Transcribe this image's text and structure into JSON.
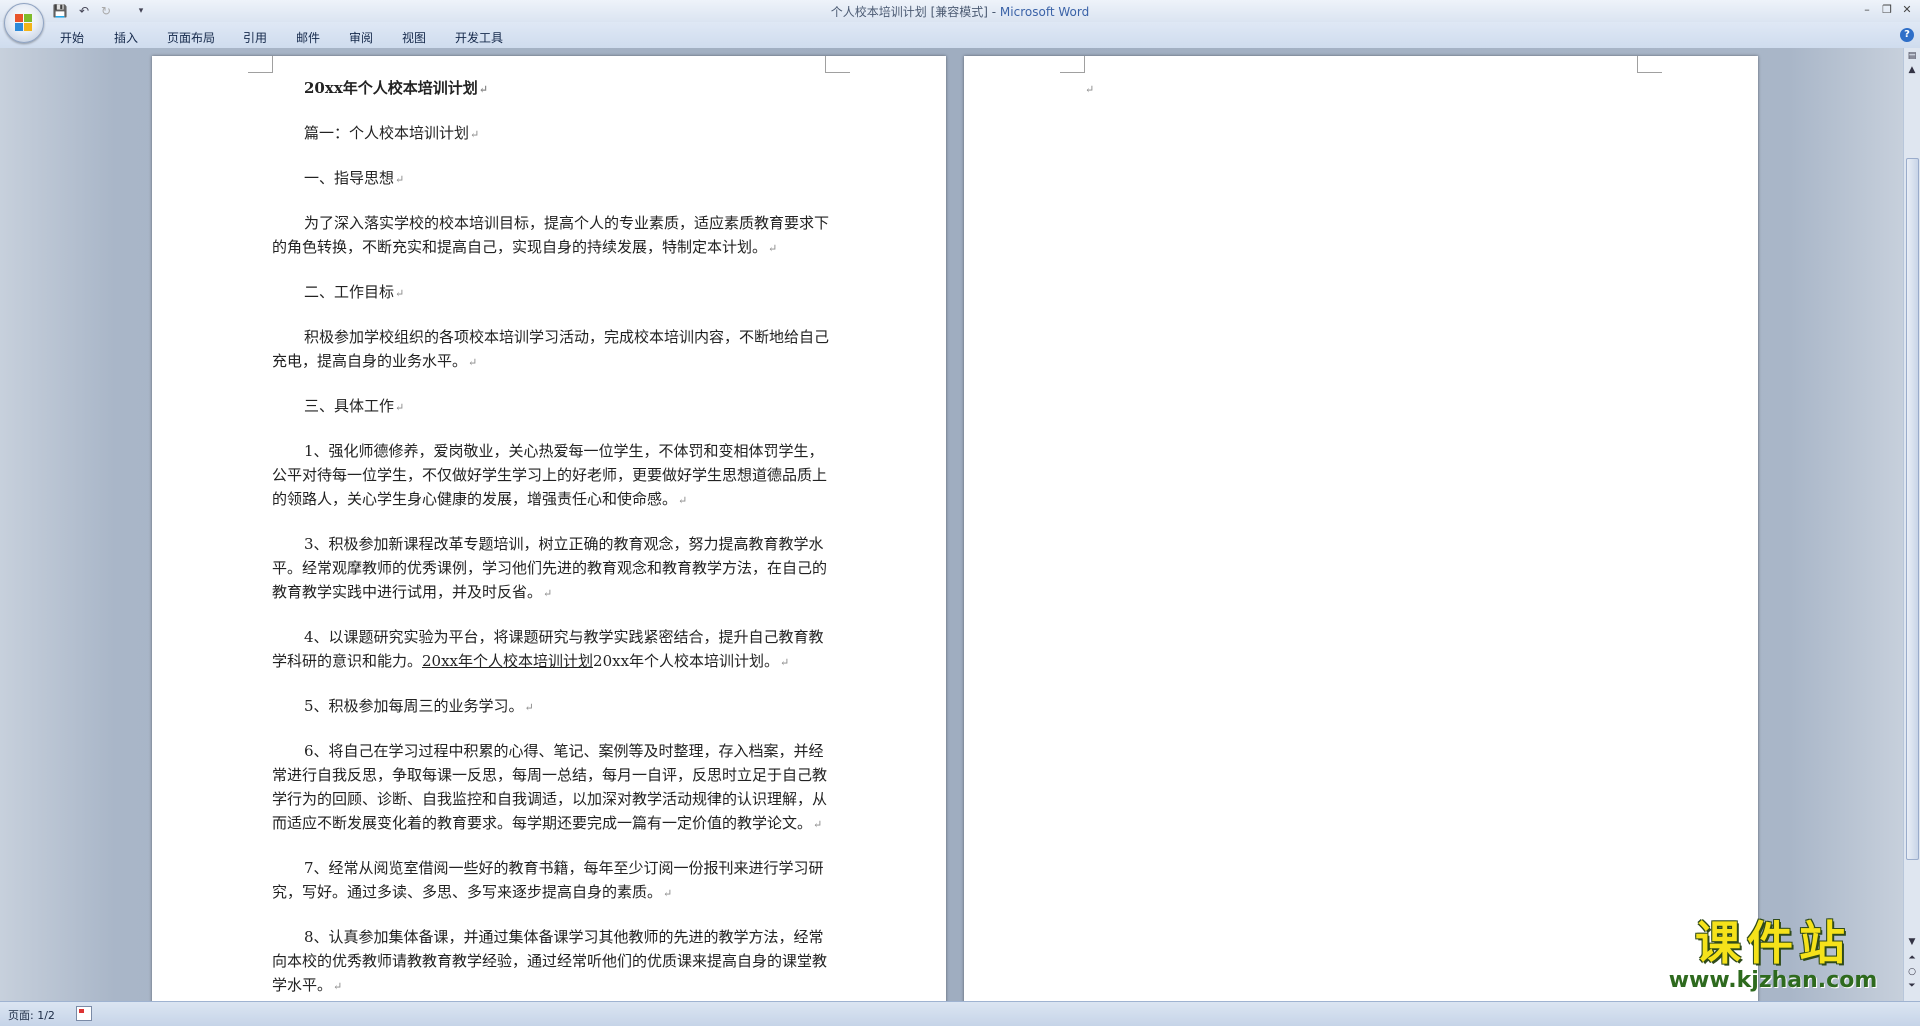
{
  "window": {
    "title": "个人校本培训计划 [兼容模式] - ",
    "app_name": "Microsoft Word"
  },
  "quick_access": [
    "save-icon",
    "undo-icon",
    "redo-icon",
    "customize-icon"
  ],
  "ribbon": {
    "tabs": [
      "开始",
      "插入",
      "页面布局",
      "引用",
      "邮件",
      "审阅",
      "视图",
      "开发工具"
    ]
  },
  "document": {
    "title": "20xx年个人校本培训计划",
    "paragraphs": [
      "篇一：个人校本培训计划",
      "一、指导思想",
      "为了深入落实学校的校本培训目标，提高个人的专业素质，适应素质教育要求下的角色转换，不断充实和提高自己，实现自身的持续发展，特制定本计划。",
      "二、工作目标",
      "积极参加学校组织的各项校本培训学习活动，完成校本培训内容，不断地给自己充电，提高自身的业务水平。",
      "三、具体工作",
      "1、强化师德修养，爱岗敬业，关心热爱每一位学生，不体罚和变相体罚学生，公平对待每一位学生，不仅做好学生学习上的好老师，更要做好学生思想道德品质上的领路人，关心学生身心健康的发展，增强责任心和使命感。",
      "3、积极参加新课程改革专题培训，树立正确的教育观念，努力提高教育教学水平。经常观摩教师的优秀课例，学习他们先进的教育观念和教育教学方法，在自己的教育教学实践中进行试用，并及时反省。"
    ],
    "para4_text": "4、以课题研究实验为平台，将课题研究与教学实践紧密结合，提升自己教育教学科研的意识和能力。",
    "para4_link": "20xx年个人校本培训计划",
    "para4_tail": "20xx年个人校本培训计划。",
    "paragraphs_after": [
      "5、积极参加每周三的业务学习。",
      "6、将自己在学习过程中积累的心得、笔记、案例等及时整理，存入档案，并经常进行自我反思，争取每课一反思，每周一总结，每月一自评，反思时立足于自己教学行为的回顾、诊断、自我监控和自我调适，以加深对教学活动规律的认识理解，从而适应不断发展变化着的教育要求。每学期还要完成一篇有一定价值的教学论文。",
      "7、经常从阅览室借阅一些好的教育书籍，每年至少订阅一份报刊来进行学习研究，写好。通过多读、多思、多写来逐步提高自身的素质。",
      "8、认真参加集体备课，并通过集体备课学习其他教师的先进的教学方法，经常向本校的优秀教师请教教育教学经验，通过经常听他们的优质课来提高自身的课堂教学水平。"
    ],
    "paragraph_mark": "↵"
  },
  "status_bar": {
    "page_label": "页面: 1/2"
  },
  "watermark": {
    "text_cn": "课件站",
    "text_url": "www.kjzhan.com"
  }
}
